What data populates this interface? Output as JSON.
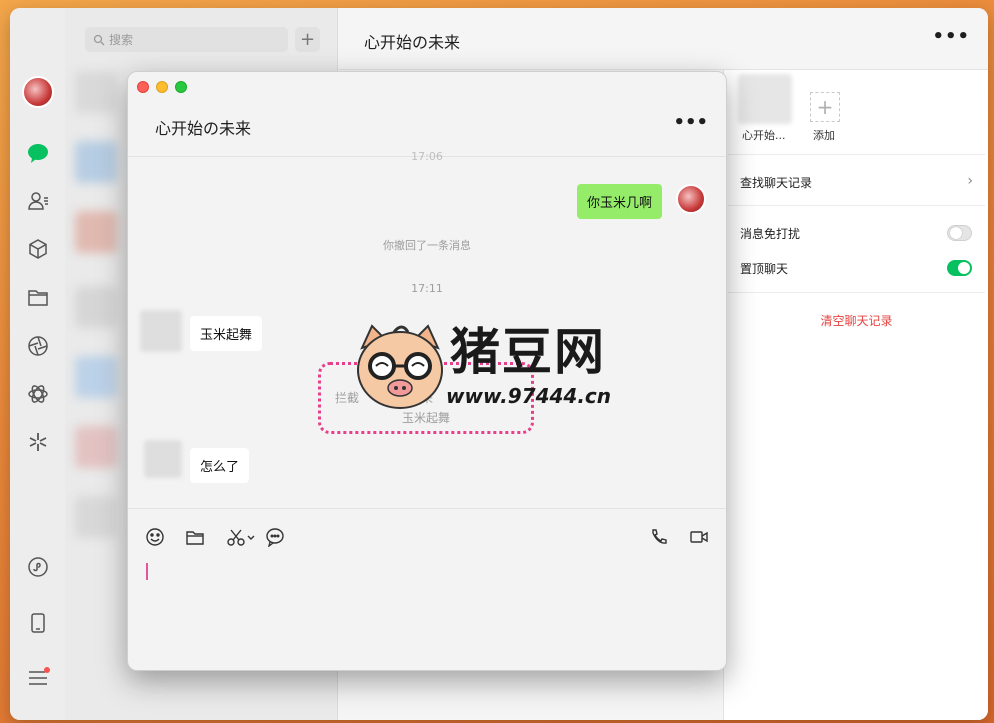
{
  "main_window": {
    "search_placeholder": "搜索",
    "add_button": "+",
    "title": "心开始の未来",
    "more": "•••"
  },
  "sidebar": {
    "icons": [
      "chat-icon",
      "contacts-icon",
      "favorites-icon",
      "folder-icon",
      "moments-icon",
      "channels-icon",
      "search-discover-icon",
      "mini-programs-icon",
      "phone-icon",
      "menu-icon"
    ]
  },
  "info_panel": {
    "member_name": "心开始...",
    "add_label": "添加",
    "find_history": "查找聊天记录",
    "mute_label": "消息免打扰",
    "pin_label": "置顶聊天",
    "clear_label": "清空聊天记录",
    "mute_on": false,
    "pin_on": true
  },
  "chat_window": {
    "title": "心开始の未来",
    "more": "•••",
    "messages": {
      "time_top": "17:06",
      "mine_text": "你玉米几啊",
      "recalled_notice": "你撤回了一条消息",
      "time_mid": "17:11",
      "other_1": "玉米起舞",
      "intercepted_prefix": "拦截",
      "intercepted_suffix": "来",
      "intercepted_text": "玉米起舞",
      "other_2": "怎么了"
    }
  },
  "watermark": {
    "brand": "猪豆网",
    "url": "www.97444.cn"
  },
  "colors": {
    "accent_green": "#07c160",
    "bubble_green": "#95ec69",
    "danger_red": "#e64340",
    "highlight_pink": "#e83e8c"
  }
}
